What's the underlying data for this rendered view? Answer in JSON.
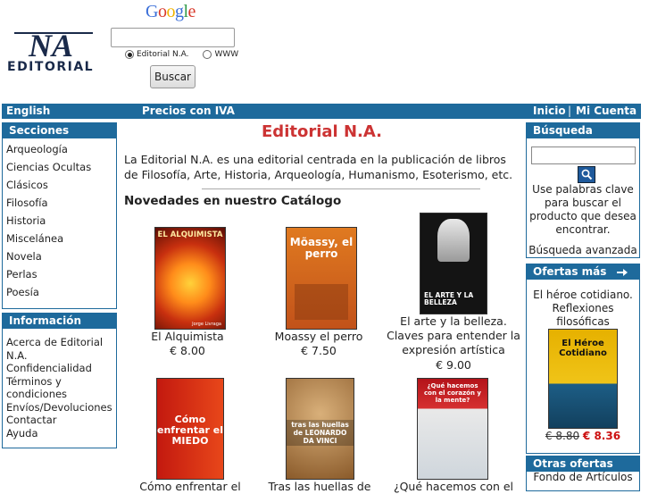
{
  "header": {
    "logo_text": "EDITORIAL",
    "google_logo": "Google",
    "search_value": "",
    "radio_options": [
      "Editorial N.A.",
      "WWW"
    ],
    "search_button": "Buscar"
  },
  "nav": {
    "english": "English",
    "prices": "Precios con IVA",
    "inicio": "Inicio",
    "separator": "|",
    "mi_cuenta": "Mi Cuenta"
  },
  "secciones": {
    "title": "Secciones",
    "items": [
      "Arqueología",
      "Ciencias Ocultas",
      "Clásicos",
      "Filosofía",
      "Historia",
      "Miscelánea",
      "Novela",
      "Perlas",
      "Poesía"
    ]
  },
  "informacion": {
    "title": "Información",
    "items": [
      "Acerca de Editorial N.A.",
      "Confidencialidad",
      "Términos y condiciones",
      "Envíos/Devoluciones",
      "Contactar",
      "Ayuda"
    ]
  },
  "main": {
    "title": "Editorial N.A.",
    "intro": "La Editorial N.A. es una editorial centrada en la publicación de libros de Filosofía, Arte, Historia, Arqueología, Humanismo, Esoterismo, etc.",
    "novedades": "Novedades en nuestro Catálogo",
    "products": [
      {
        "name": "El Alquimista",
        "price": "€ 8.00",
        "cover_title": "EL ALQUIMISTA",
        "cover_author": "Jorge Livraga"
      },
      {
        "name": "Moassy el perro",
        "price": "€ 7.50",
        "cover_title": "Mõassy, el perro",
        "cover_sub": ""
      },
      {
        "name": "El arte y la belleza. Claves para entender la expresión artística",
        "price": "€ 9.00",
        "cover_title": "EL ARTE Y LA BELLEZA",
        "cover_sub": "Claves para entender la expresión artística"
      },
      {
        "name": "Cómo enfrentar el",
        "cover_title": "Cómo enfrentar el MIEDO"
      },
      {
        "name": "Tras las huellas de",
        "cover_title": "tras las huellas de LEONARDO DA VINCI"
      },
      {
        "name": "¿Qué hacemos con el",
        "cover_title": "¿Qué hacemos con el corazón y la mente?"
      }
    ]
  },
  "busqueda": {
    "title": "Búsqueda",
    "search_value": "",
    "help": "Use palabras clave para buscar el producto que desea encontrar.",
    "advanced": "Búsqueda avanzada"
  },
  "ofertas": {
    "title": "Ofertas más",
    "product_name": "El héroe cotidiano. Reflexiones filosóficas",
    "cover_title": "El Héroe Cotidiano",
    "old_price": "€ 8.80",
    "new_price": "€ 8.36"
  },
  "otras": {
    "title": "Otras ofertas",
    "text": "Fondo de Artículos"
  },
  "colors": {
    "nav_blue": "#1e6a9c",
    "title_red": "#cc3333",
    "sale_red": "#cc1111"
  }
}
